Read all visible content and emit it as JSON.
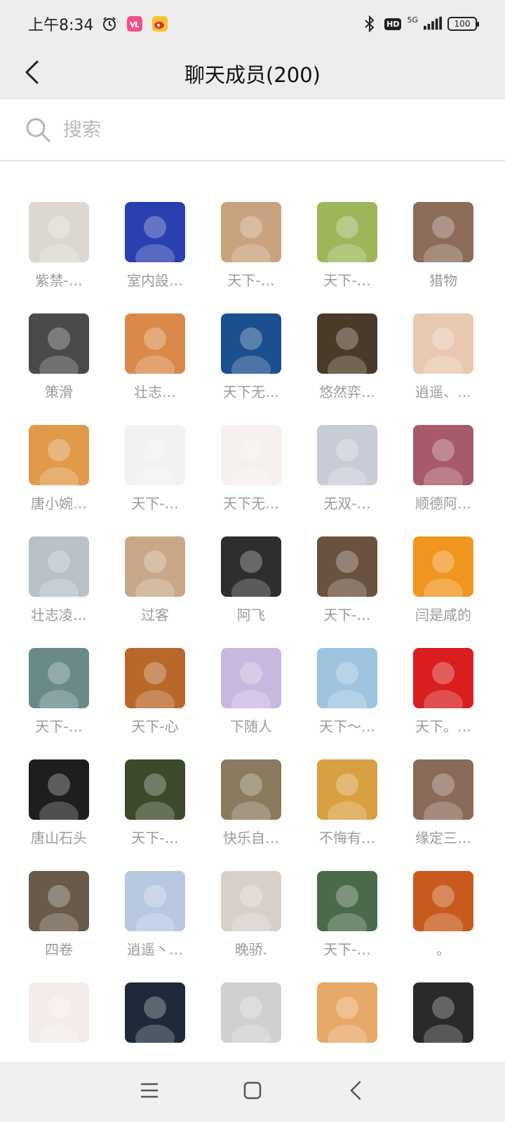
{
  "status_bar": {
    "time": "上午8:34",
    "network": "5G",
    "battery": "100",
    "icons": [
      "alarm-icon",
      "vlog-app-icon",
      "weibo-app-icon",
      "bluetooth-icon",
      "hd-icon",
      "signal-icon",
      "battery-icon"
    ]
  },
  "header": {
    "title": "聊天成员(200)",
    "back_icon": "chevron-left-icon"
  },
  "search": {
    "placeholder": "搜索",
    "value": ""
  },
  "members": [
    {
      "name": "紫禁-…",
      "color": "#dcd8cf"
    },
    {
      "name": "室内設…",
      "color": "#2a3fb0"
    },
    {
      "name": "天下-…",
      "color": "#c9a27e"
    },
    {
      "name": "天下-…",
      "color": "#9fb55a"
    },
    {
      "name": "猎物",
      "color": "#8c6d5a"
    },
    {
      "name": "策滑",
      "color": "#4a4a4a"
    },
    {
      "name": "壮志…",
      "color": "#d98a4a"
    },
    {
      "name": "天下无…",
      "color": "#1c4f8f"
    },
    {
      "name": "悠然弈…",
      "color": "#4a3a28"
    },
    {
      "name": "逍遥、…",
      "color": "#e8c8b0"
    },
    {
      "name": "唐小婉…",
      "color": "#e09a4a"
    },
    {
      "name": "天下-…",
      "color": "#f2f2f2"
    },
    {
      "name": "天下无…",
      "color": "#f6f0ee"
    },
    {
      "name": "无双-…",
      "color": "#c8ccd6"
    },
    {
      "name": "顺德阿…",
      "color": "#a85a6a"
    },
    {
      "name": "壮志凌…",
      "color": "#b8c0c8"
    },
    {
      "name": "过客",
      "color": "#c8a888"
    },
    {
      "name": "阿飞",
      "color": "#2e2e2e"
    },
    {
      "name": "天下-…",
      "color": "#6a5240"
    },
    {
      "name": "闫是咸的",
      "color": "#f0951e"
    },
    {
      "name": "天下-…",
      "color": "#6a8a8a"
    },
    {
      "name": "天下-心",
      "color": "#b8682a"
    },
    {
      "name": "下随人",
      "color": "#c8b8e0"
    },
    {
      "name": "天下～…",
      "color": "#9ec4e0"
    },
    {
      "name": "天下。…",
      "color": "#d81e1e"
    },
    {
      "name": "唐山石头",
      "color": "#1e1e1e"
    },
    {
      "name": "天下-…",
      "color": "#3a4a2a"
    },
    {
      "name": "快乐自…",
      "color": "#8a7a5e"
    },
    {
      "name": "不悔有…",
      "color": "#d8a040"
    },
    {
      "name": "缘定三…",
      "color": "#8a6a58"
    },
    {
      "name": "四卷",
      "color": "#6a5a4a"
    },
    {
      "name": "逍遥丶…",
      "color": "#b8c8e0"
    },
    {
      "name": "晚骄.",
      "color": "#d8d0c8"
    },
    {
      "name": "天下-…",
      "color": "#4a6a4a"
    },
    {
      "name": "。",
      "color": "#c85a1e"
    },
    {
      "name": "",
      "color": "#f4ecea"
    },
    {
      "name": "",
      "color": "#1e2a3a"
    },
    {
      "name": "",
      "color": "#d0d0d0"
    },
    {
      "name": "",
      "color": "#e8a868"
    },
    {
      "name": "",
      "color": "#2a2a2a"
    }
  ],
  "system_nav": {
    "icons": [
      "menu-icon",
      "home-icon",
      "back-icon"
    ]
  }
}
